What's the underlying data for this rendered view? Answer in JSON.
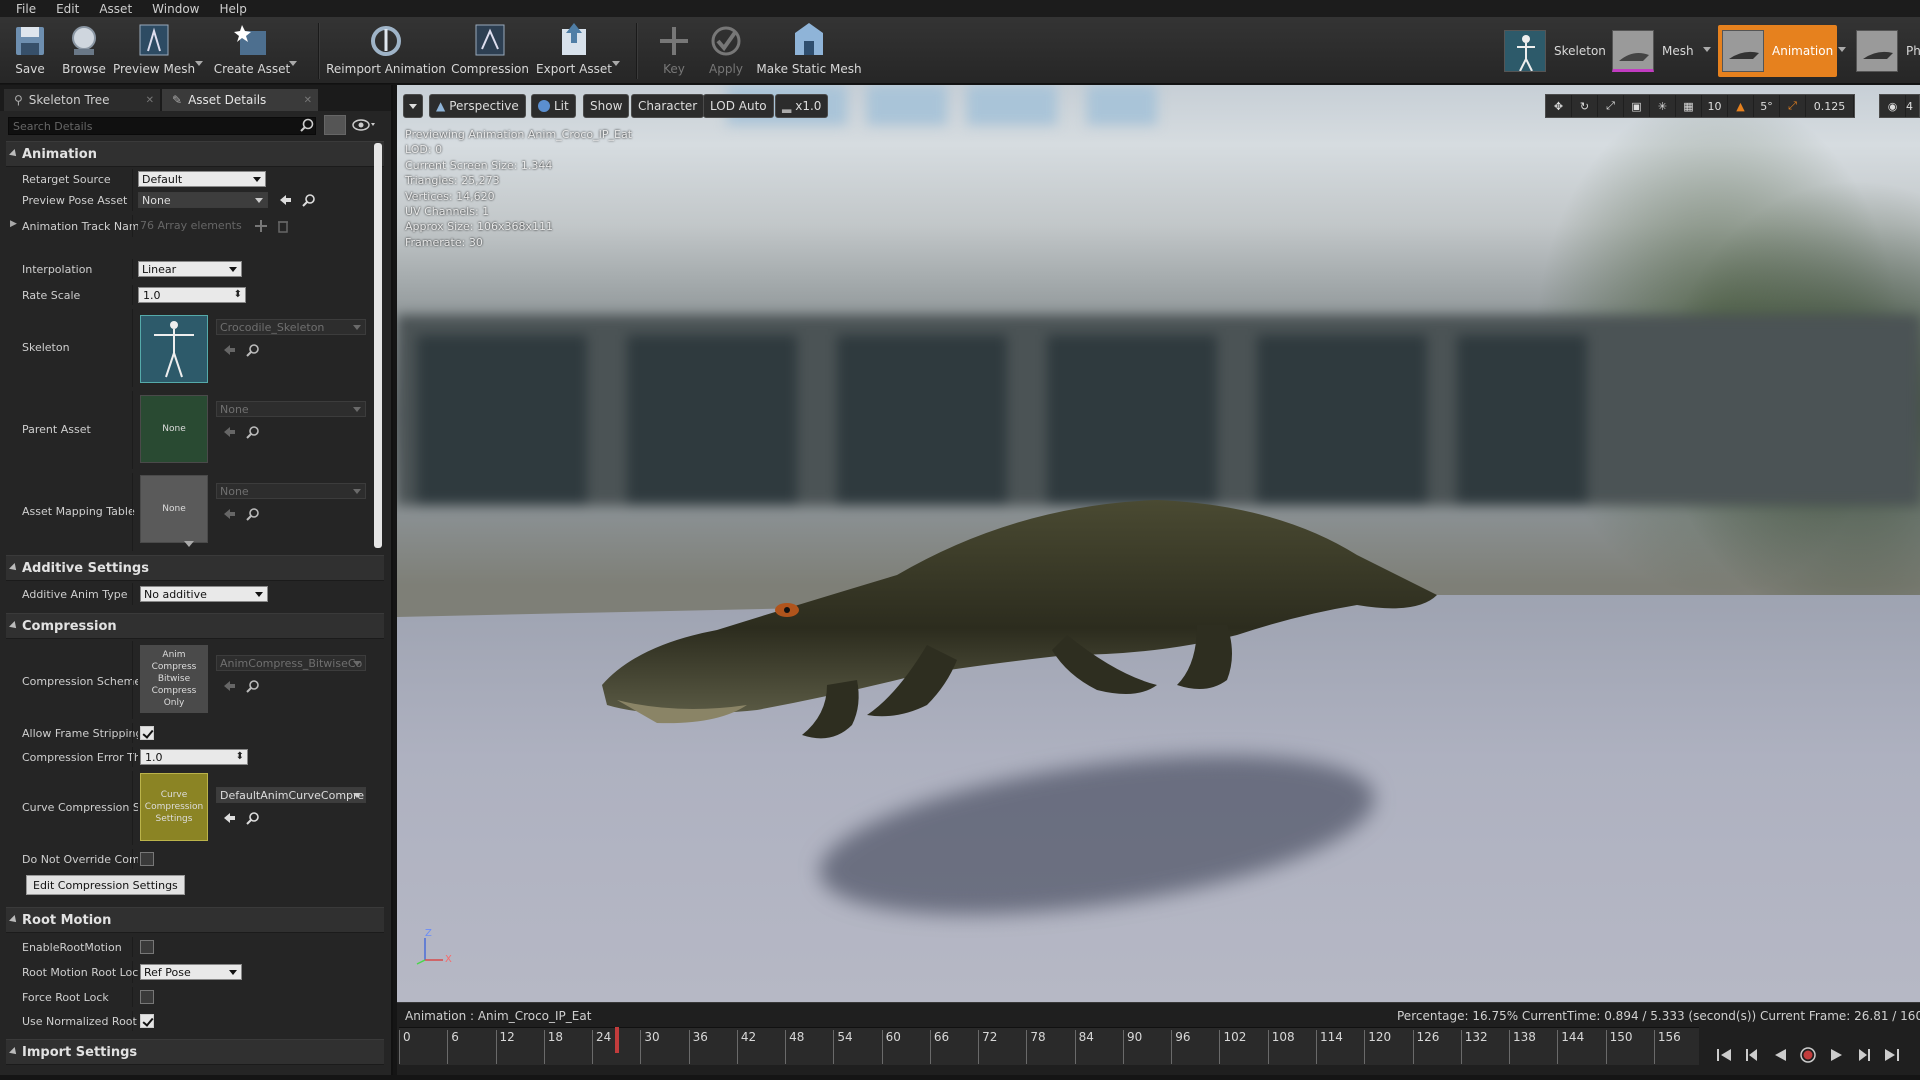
{
  "menu": [
    "File",
    "Edit",
    "Asset",
    "Window",
    "Help"
  ],
  "toolbar": {
    "save": "Save",
    "browse": "Browse",
    "preview_mesh": "Preview Mesh",
    "create_asset": "Create Asset",
    "reimport": "Reimport Animation",
    "compression": "Compression",
    "export": "Export Asset",
    "key": "Key",
    "apply": "Apply",
    "make_static_mesh": "Make Static Mesh"
  },
  "modes": {
    "skeleton": "Skeleton",
    "mesh": "Mesh",
    "animation": "Animation",
    "physics_partial": "Ph"
  },
  "tabs": {
    "skeleton_tree": "Skeleton Tree",
    "asset_details": "Asset Details"
  },
  "search": {
    "placeholder": "Search Details"
  },
  "details": {
    "animation_section": "Animation",
    "retarget_source_label": "Retarget Source",
    "retarget_source_value": "Default",
    "preview_pose_label": "Preview Pose Asset",
    "preview_pose_value": "None",
    "track_names_label": "Animation Track Nam",
    "track_names_value": "76 Array elements",
    "interpolation_label": "Interpolation",
    "interpolation_value": "Linear",
    "rate_scale_label": "Rate Scale",
    "rate_scale_value": "1.0",
    "skeleton_label": "Skeleton",
    "skeleton_value": "Crocodile_Skeleton",
    "parent_asset_label": "Parent Asset",
    "parent_asset_thumb": "None",
    "parent_asset_value": "None",
    "asset_mapping_label": "Asset Mapping Table",
    "asset_mapping_thumb": "None",
    "asset_mapping_value": "None",
    "additive_section": "Additive Settings",
    "additive_type_label": "Additive Anim Type",
    "additive_type_value": "No additive",
    "compression_section": "Compression",
    "compression_scheme_label": "Compression Scheme",
    "compression_scheme_thumb": "Anim Compress Bitwise Compress Only",
    "compression_scheme_value": "AnimCompress_BitwiseCo",
    "allow_frame_stripping_label": "Allow Frame Stripping",
    "allow_frame_stripping_checked": true,
    "compression_error_label": "Compression Error Th",
    "compression_error_value": "1.0",
    "curve_compression_label": "Curve Compression S",
    "curve_compression_thumb": "Curve Compression Settings",
    "curve_compression_value": "DefaultAnimCurveCompre",
    "do_not_override_label": "Do Not Override Comp",
    "do_not_override_checked": false,
    "edit_compression_button": "Edit Compression Settings",
    "root_motion_section": "Root Motion",
    "enable_root_motion_label": "EnableRootMotion",
    "enable_root_motion_checked": false,
    "root_motion_lock_label": "Root Motion Root Loc",
    "root_motion_lock_value": "Ref Pose",
    "force_root_lock_label": "Force Root Lock",
    "force_root_lock_checked": false,
    "use_normalized_root_label": "Use Normalized Root",
    "use_normalized_root_checked": true,
    "import_section": "Import Settings"
  },
  "viewport": {
    "perspective": "Perspective",
    "lit": "Lit",
    "show": "Show",
    "character": "Character",
    "lod": "LOD Auto",
    "speed": "x1.0",
    "grid_snap": "10",
    "rotation_snap": "5°",
    "scale_snap": "0.125",
    "camera_speed": "4",
    "stats": [
      "Previewing Animation Anim_Croco_IP_Eat",
      "LOD: 0",
      "Current Screen Size: 1.344",
      "Triangles: 25,273",
      "Vertices: 14,620",
      "UV Channels: 1",
      "Approx Size: 106x368x111",
      "Framerate: 30"
    ],
    "axis_z": "Z",
    "axis_x": "X"
  },
  "timeline": {
    "animation_label": "Animation :  Anim_Croco_IP_Eat",
    "status": "Percentage: 16.75% CurrentTime: 0.894 / 5.333 (second(s)) Current Frame: 26.81 / 160 Fram",
    "ticks": [
      "0",
      "6",
      "12",
      "18",
      "24",
      "30",
      "36",
      "42",
      "48",
      "54",
      "60",
      "66",
      "72",
      "78",
      "84",
      "90",
      "96",
      "102",
      "108",
      "114",
      "120",
      "126",
      "132",
      "138",
      "144",
      "150",
      "156"
    ],
    "current_frame": 26.81,
    "total_frames": 160
  },
  "colors": {
    "accent_orange": "#e6811e",
    "panel_bg": "#252525",
    "timeline_cursor": "#c23c3c",
    "curve_thumb": "#8b8424",
    "skeleton_thumb": "#2d5a6a",
    "parent_thumb": "#294a32"
  }
}
